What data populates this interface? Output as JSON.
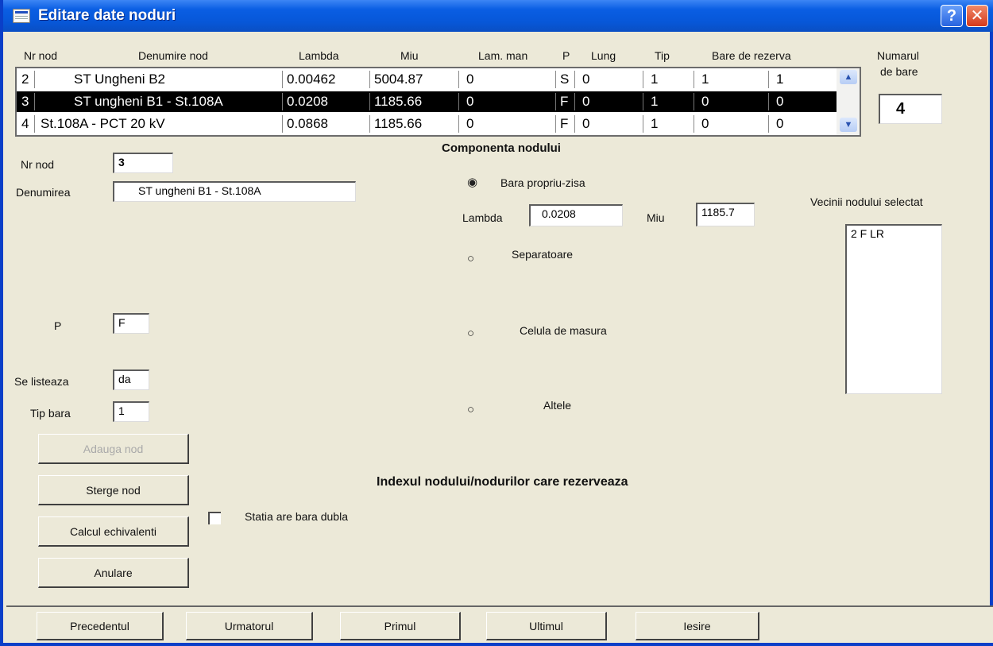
{
  "window": {
    "title": "Editare date noduri"
  },
  "grid": {
    "headers": {
      "nr": "Nr nod",
      "name": "Denumire nod",
      "lambda": "Lambda",
      "miu": "Miu",
      "lam_man": "Lam. man",
      "p": "P",
      "lung": "Lung",
      "tip": "Tip",
      "bare": "Bare de rezerva"
    },
    "rows": [
      {
        "nr": "2",
        "name": "ST Ungheni B2",
        "lambda": "0.00462",
        "miu": "5004.87",
        "lam_man": "0",
        "p": "S",
        "lung": "0",
        "tip": "1",
        "b1": "1",
        "b2": "1"
      },
      {
        "nr": "3",
        "name": "ST ungheni B1 - St.108A",
        "lambda": "0.0208",
        "miu": "1185.66",
        "lam_man": "0",
        "p": "F",
        "lung": "0",
        "tip": "1",
        "b1": "0",
        "b2": "0"
      },
      {
        "nr": "4",
        "name": "St.108A - PCT 20 kV",
        "lambda": "0.0868",
        "miu": "1185.66",
        "lam_man": "0",
        "p": "F",
        "lung": "0",
        "tip": "1",
        "b1": "0",
        "b2": "0"
      }
    ],
    "selected_index": 1
  },
  "numar_bare": {
    "label1": "Numarul",
    "label2": "de bare",
    "value": "4"
  },
  "form": {
    "nr_nod_label": "Nr nod",
    "nr_nod_value": "3",
    "denumirea_label": "Denumirea",
    "denumirea_value": "ST ungheni B1 - St.108A",
    "p_label": "P",
    "p_value": "F",
    "se_listeaza_label": "Se listeaza",
    "se_listeaza_value": "da",
    "tip_bara_label": "Tip bara",
    "tip_bara_value": "1"
  },
  "componenta": {
    "title": "Componenta nodului",
    "options": [
      "Bara propriu-zisa",
      "Separatoare",
      "Celula de masura",
      "Altele"
    ],
    "selected": "Bara propriu-zisa",
    "lambda_label": "Lambda",
    "lambda_value": "0.0208",
    "miu_label": "Miu",
    "miu_value": "1185.7"
  },
  "vecini": {
    "title": "Vecinii nodului selectat",
    "items": [
      "2 F LR"
    ]
  },
  "actions": {
    "adauga": "Adauga nod",
    "sterge": "Sterge nod",
    "calcul": "Calcul echivalenti",
    "anulare": "Anulare"
  },
  "index_title": "Indexul nodului/nodurilor care rezerveaza",
  "statia_dubla": {
    "label": "Statia are bara dubla",
    "checked": false
  },
  "nav": {
    "precedentul": "Precedentul",
    "urmatorul": "Urmatorul",
    "primul": "Primul",
    "ultimul": "Ultimul",
    "iesire": "Iesire"
  },
  "colors": {
    "titlebar": "#0757d8",
    "window_bg": "#ece9d8",
    "selection": "#000000"
  }
}
